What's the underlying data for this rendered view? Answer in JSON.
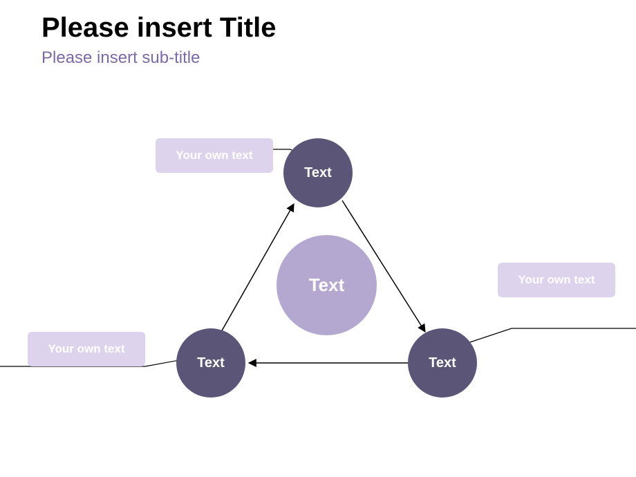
{
  "header": {
    "title": "Please insert Title",
    "subtitle": "Please insert sub-title"
  },
  "diagram": {
    "center_label": "Text",
    "nodes": {
      "top": {
        "label": "Text",
        "callout": "Your own text"
      },
      "left": {
        "label": "Text",
        "callout": "Your own text"
      },
      "right": {
        "label": "Text",
        "callout": "Your own text"
      }
    }
  }
}
